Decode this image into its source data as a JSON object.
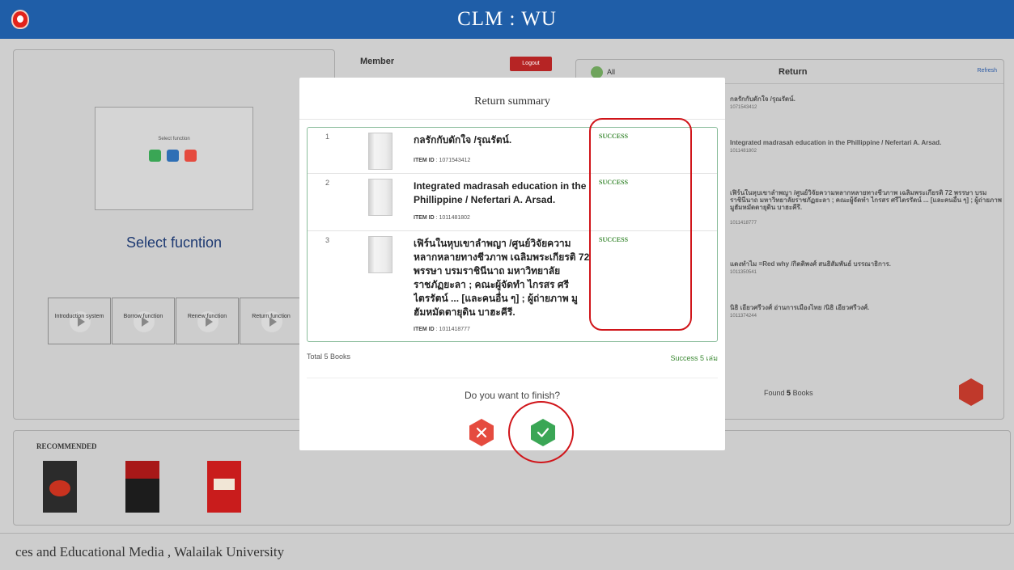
{
  "header": {
    "title": "CLM : WU"
  },
  "left_panel": {
    "preview_text": "Select function",
    "select_title": "Select fucntion",
    "tiles": [
      {
        "label": "Introduction system",
        "color": "#8fb3d6"
      },
      {
        "label": "Borrow function",
        "color": "#9fc489"
      },
      {
        "label": "Renew function",
        "color": "#e3c46a"
      },
      {
        "label": "Return function",
        "color": "#e39a6a"
      }
    ]
  },
  "member_panel": {
    "title": "Member",
    "logout_label": "Logout"
  },
  "return_panel": {
    "all_label": "All",
    "title": "Return",
    "refresh_label": "Refresh",
    "items": [
      {
        "title": "กลรักกับดักใจ /รุณรัตน์.",
        "item_id": "1071543412"
      },
      {
        "title": "Integrated madrasah education in the Phillippine / Nefertari A. Arsad.",
        "item_id": "1011481802"
      },
      {
        "title": "เฟิร์นในหุบเขาลำพญา /ศูนย์วิจัยความหลากหลายทางชีวภาพ เฉลิมพระเกียรติ 72 พรรษา บรมราชินีนาถ มหาวิทยาลัยราชภัฏยะลา ; คณะผู้จัดทำ ไกรสร ศรีไตรรัตน์ ... [และคนอื่น ๆ] ; ผู้ถ่ายภาพ มูฮัมหมัดตายุดิน บาฮะคีรี.",
        "item_id": "1011418777"
      },
      {
        "title": "แดงทำไม =Red why /กิตติพงศ์ สนธิสัมพันธ์ บรรณาธิการ.",
        "item_id": "1011350541"
      },
      {
        "title": "นิธิ เอียวศรีวงศ์ อ่านการเมืองไทย /นิธิ เอียวศรีวงศ์.",
        "item_id": "1011374244"
      }
    ],
    "found_prefix": "Found",
    "found_count": "5",
    "found_suffix": "Books"
  },
  "recommended": {
    "title": "RECOMMENDED",
    "books": [
      {
        "cover_color": "#2b2b2b",
        "accent": "#c8321f"
      },
      {
        "cover_color": "#1c1c1c",
        "accent": "#a81818"
      },
      {
        "cover_color": "#c91c1c",
        "accent": "#ffffff"
      }
    ]
  },
  "footer": {
    "text": "ces and Educational Media , Walailak University"
  },
  "modal": {
    "title": "Return summary",
    "id_label": "ITEM ID",
    "rows": [
      {
        "num": "1",
        "title": "กลรักกับดักใจ /รุณรัตน์.",
        "item_id": "1071543412",
        "status": "SUCCESS"
      },
      {
        "num": "2",
        "title": "Integrated madrasah education in the Phillippine / Nefertari A. Arsad.",
        "item_id": "1011481802",
        "status": "SUCCESS"
      },
      {
        "num": "3",
        "title": "เฟิร์นในหุบเขาลำพญา /ศูนย์วิจัยความหลากหลายทางชีวภาพ เฉลิมพระเกียรติ 72 พรรษา บรมราชินีนาถ มหาวิทยาลัยราชภัฏยะลา ; คณะผู้จัดทำ ไกรสร ศรีไตรรัตน์ ... [และคนอื่น ๆ] ; ผู้ถ่ายภาพ มูฮัมหมัดตายุดิน บาฮะคีรี.",
        "item_id": "1011418777",
        "status": "SUCCESS"
      }
    ],
    "total_text": "Total 5 Books",
    "success_text": "Success 5 เล่ม",
    "question": "Do you want to finish?",
    "colors": {
      "success": "#3d8a35",
      "cancel": "#e54b3f",
      "confirm": "#3aa655"
    }
  }
}
